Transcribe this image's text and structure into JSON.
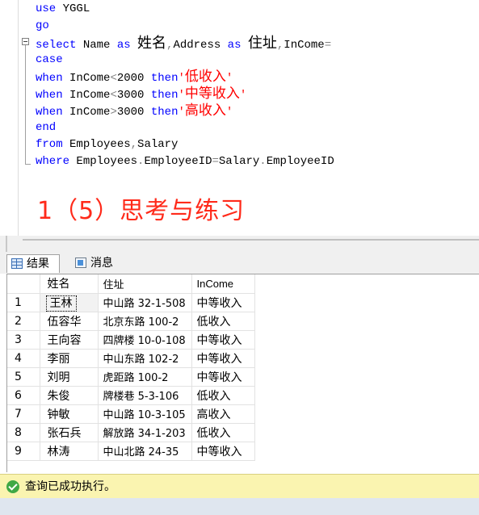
{
  "editor": {
    "lines": [
      {
        "parts": [
          {
            "t": "use ",
            "c": "kw"
          },
          {
            "t": "YGGL",
            "c": "id"
          }
        ]
      },
      {
        "parts": [
          {
            "t": "go",
            "c": "kw"
          }
        ]
      },
      {
        "parts": [
          {
            "t": "select ",
            "c": "kw"
          },
          {
            "t": "Name ",
            "c": "id"
          },
          {
            "t": "as ",
            "c": "kw"
          },
          {
            "t": "姓名",
            "c": "cjk"
          },
          {
            "t": ",",
            "c": "sym"
          },
          {
            "t": "Address ",
            "c": "id"
          },
          {
            "t": "as ",
            "c": "kw"
          },
          {
            "t": "住址",
            "c": "cjk"
          },
          {
            "t": ",",
            "c": "sym"
          },
          {
            "t": "InCome",
            "c": "id"
          },
          {
            "t": "=",
            "c": "sym"
          }
        ]
      },
      {
        "parts": [
          {
            "t": "case",
            "c": "kw"
          }
        ]
      },
      {
        "parts": [
          {
            "t": "when ",
            "c": "kw"
          },
          {
            "t": "InCome",
            "c": "id"
          },
          {
            "t": "<",
            "c": "sym"
          },
          {
            "t": "2000 ",
            "c": "id"
          },
          {
            "t": "then",
            "c": "kw"
          },
          {
            "t": "'",
            "c": "str"
          },
          {
            "t": "低收入",
            "c": "strcjk"
          },
          {
            "t": "'",
            "c": "str"
          }
        ]
      },
      {
        "parts": [
          {
            "t": "when ",
            "c": "kw"
          },
          {
            "t": "InCome",
            "c": "id"
          },
          {
            "t": "<",
            "c": "sym"
          },
          {
            "t": "3000 ",
            "c": "id"
          },
          {
            "t": "then",
            "c": "kw"
          },
          {
            "t": "'",
            "c": "str"
          },
          {
            "t": "中等收入",
            "c": "strcjk"
          },
          {
            "t": "'",
            "c": "str"
          }
        ]
      },
      {
        "parts": [
          {
            "t": "when ",
            "c": "kw"
          },
          {
            "t": "InCome",
            "c": "id"
          },
          {
            "t": ">",
            "c": "sym"
          },
          {
            "t": "3000 ",
            "c": "id"
          },
          {
            "t": "then",
            "c": "kw"
          },
          {
            "t": "'",
            "c": "str"
          },
          {
            "t": "高收入",
            "c": "strcjk"
          },
          {
            "t": "'",
            "c": "str"
          }
        ]
      },
      {
        "parts": [
          {
            "t": "end",
            "c": "kw"
          }
        ]
      },
      {
        "parts": [
          {
            "t": "from ",
            "c": "kw"
          },
          {
            "t": "Employees",
            "c": "id"
          },
          {
            "t": ",",
            "c": "sym"
          },
          {
            "t": "Salary",
            "c": "id"
          }
        ]
      },
      {
        "parts": [
          {
            "t": "where ",
            "c": "kw"
          },
          {
            "t": "Employees",
            "c": "id"
          },
          {
            "t": ".",
            "c": "sym"
          },
          {
            "t": "EmployeeID",
            "c": "id"
          },
          {
            "t": "=",
            "c": "sym"
          },
          {
            "t": "Salary",
            "c": "id"
          },
          {
            "t": ".",
            "c": "sym"
          },
          {
            "t": "EmployeeID",
            "c": "id"
          }
        ]
      }
    ],
    "heading": "1（5）思考与练习"
  },
  "tabs": {
    "results": "结果",
    "messages": "消息"
  },
  "grid": {
    "columns": [
      "姓名",
      "住址",
      "InCome"
    ],
    "rows": [
      {
        "n": "1",
        "name": "王林",
        "addr": "中山路 32-1-508",
        "inc": "中等收入"
      },
      {
        "n": "2",
        "name": "伍容华",
        "addr": "北京东路 100-2",
        "inc": "低收入"
      },
      {
        "n": "3",
        "name": "王向容",
        "addr": "四牌楼 10-0-108",
        "inc": "中等收入"
      },
      {
        "n": "4",
        "name": "李丽",
        "addr": "中山东路 102-2",
        "inc": "中等收入"
      },
      {
        "n": "5",
        "name": "刘明",
        "addr": "虎距路 100-2",
        "inc": "中等收入"
      },
      {
        "n": "6",
        "name": "朱俊",
        "addr": "牌楼巷 5-3-106",
        "inc": "低收入"
      },
      {
        "n": "7",
        "name": "钟敏",
        "addr": "中山路 10-3-105",
        "inc": "高收入"
      },
      {
        "n": "8",
        "name": "张石兵",
        "addr": "解放路 34-1-203",
        "inc": "低收入"
      },
      {
        "n": "9",
        "name": "林涛",
        "addr": "中山北路 24-35",
        "inc": "中等收入"
      }
    ]
  },
  "status": {
    "text": "查询已成功执行。"
  },
  "colors": {
    "keyword": "#0000ff",
    "string": "#ff0000",
    "status_bg": "#faf4b0",
    "success": "#3fa845"
  },
  "icons": [
    "collapse-icon",
    "results-grid-icon",
    "messages-icon",
    "success-check-icon"
  ]
}
